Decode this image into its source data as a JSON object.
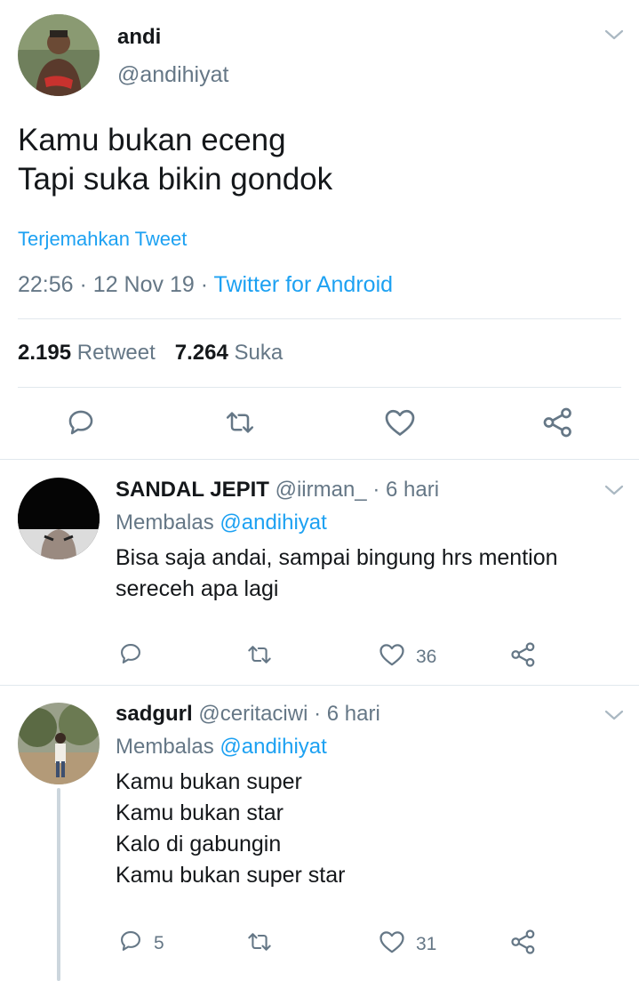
{
  "main_tweet": {
    "name": "andi",
    "handle": "@andihiyat",
    "text_lines": [
      "Kamu bukan eceng",
      "Tapi suka bikin gondok"
    ],
    "translate_label": "Terjemahkan Tweet",
    "time": "22:56",
    "date": "12 Nov 19",
    "separator": "·",
    "source": "Twitter for Android",
    "retweet_count": "2.195",
    "retweet_label": "Retweet",
    "like_count": "7.264",
    "like_label": "Suka"
  },
  "replies": [
    {
      "name": "SANDAL JEPIT",
      "handle": "@iirman_",
      "age": "· 6 hari",
      "reply_prefix": "Membalas",
      "reply_to": "@andihiyat",
      "text_lines": [
        "Bisa saja andai,  sampai bingung hrs mention",
        "sereceh apa lagi"
      ],
      "reply_count": "",
      "like_count": "36"
    },
    {
      "name": "sadgurl",
      "handle": "@ceritaciwi",
      "age": "· 6 hari",
      "reply_prefix": "Membalas",
      "reply_to": "@andihiyat",
      "text_lines": [
        "Kamu bukan super",
        "Kamu bukan star",
        "Kalo di gabungin",
        "Kamu bukan super star"
      ],
      "reply_count": "5",
      "like_count": "31"
    }
  ],
  "colors": {
    "accent": "#1da1f2",
    "text_primary": "#14171a",
    "text_secondary": "#657786",
    "divider": "#e1e8ed"
  },
  "icons": [
    "chevron-down-icon",
    "reply-icon",
    "retweet-icon",
    "like-icon",
    "share-icon"
  ]
}
